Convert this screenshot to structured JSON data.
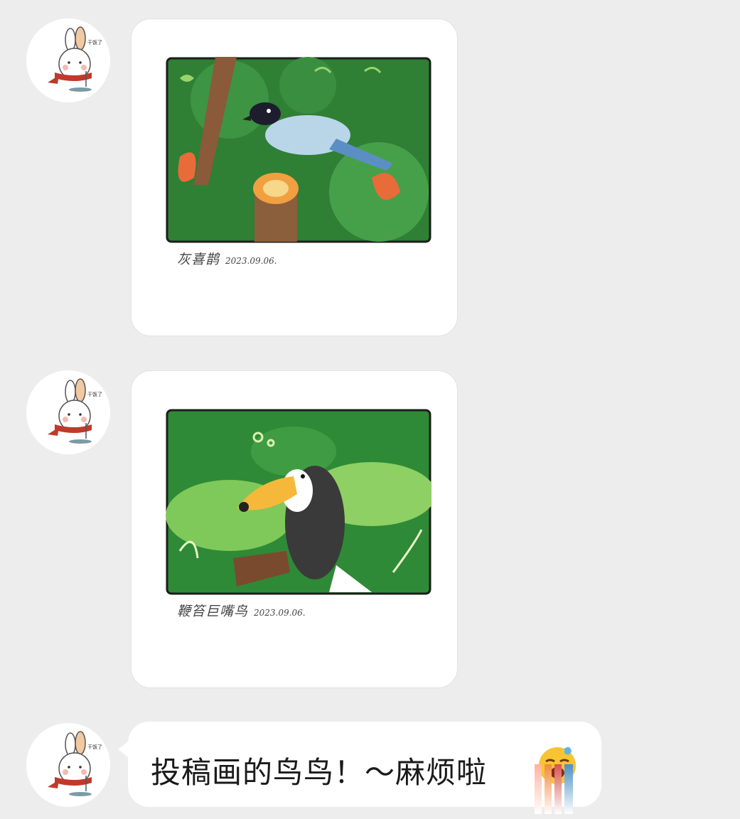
{
  "messages": [
    {
      "type": "image",
      "caption_name": "灰喜鹊",
      "caption_date": "2023.09.06.",
      "bird": "azure-winged-magpie"
    },
    {
      "type": "image",
      "caption_name": "鞭笞巨嘴鸟",
      "caption_date": "2023.09.06.",
      "bird": "toco-toucan"
    },
    {
      "type": "text",
      "text": "投稿画的鸟鸟！～麻烦啦",
      "emoji": "crying-face-emoji"
    }
  ],
  "avatar": {
    "label": "干饭了",
    "icon": "bunny-avatar-icon"
  },
  "colors": {
    "background": "#ededed",
    "bubble": "#ffffff",
    "forest_dark": "#1f6b2c",
    "forest_light": "#4da848"
  }
}
